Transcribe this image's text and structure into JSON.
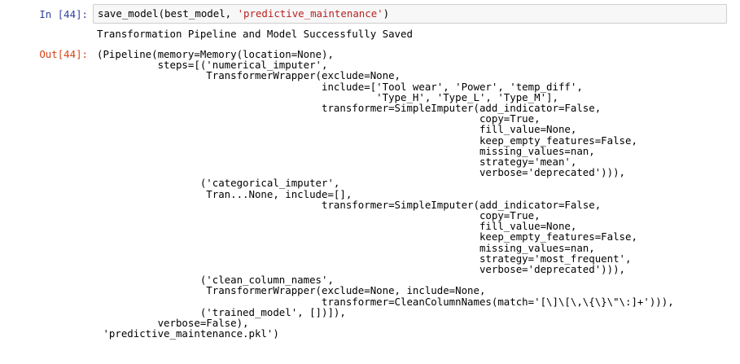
{
  "cell": {
    "in_prompt": "In [44]:",
    "out_prompt": "Out[44]:",
    "code": {
      "function_call": "save_model(best_model, ",
      "string_arg": "'predictive_maintenance'",
      "close": ")"
    },
    "stdout": "Transformation Pipeline and Model Successfully Saved",
    "output_text": "(Pipeline(memory=Memory(location=None),\n          steps=[('numerical_imputer',\n                  TransformerWrapper(exclude=None,\n                                     include=['Tool wear', 'Power', 'temp_diff',\n                                              'Type_H', 'Type_L', 'Type_M'],\n                                     transformer=SimpleImputer(add_indicator=False,\n                                                               copy=True,\n                                                               fill_value=None,\n                                                               keep_empty_features=False,\n                                                               missing_values=nan,\n                                                               strategy='mean',\n                                                               verbose='deprecated'))),\n                 ('categorical_imputer',\n                  Tran...None, include=[],\n                                     transformer=SimpleImputer(add_indicator=False,\n                                                               copy=True,\n                                                               fill_value=None,\n                                                               keep_empty_features=False,\n                                                               missing_values=nan,\n                                                               strategy='most_frequent',\n                                                               verbose='deprecated'))),\n                 ('clean_column_names',\n                  TransformerWrapper(exclude=None, include=None,\n                                     transformer=CleanColumnNames(match='[\\]\\[\\,\\{\\}\\\"\\:]+'))),\n                 ('trained_model', [])]),\n          verbose=False),\n 'predictive_maintenance.pkl')"
  },
  "colors": {
    "in_prompt": "#303f9f",
    "out_prompt": "#d84315",
    "string": "#ba2121",
    "input_bg": "#f7f7f7",
    "input_border": "#cfcfcf"
  }
}
